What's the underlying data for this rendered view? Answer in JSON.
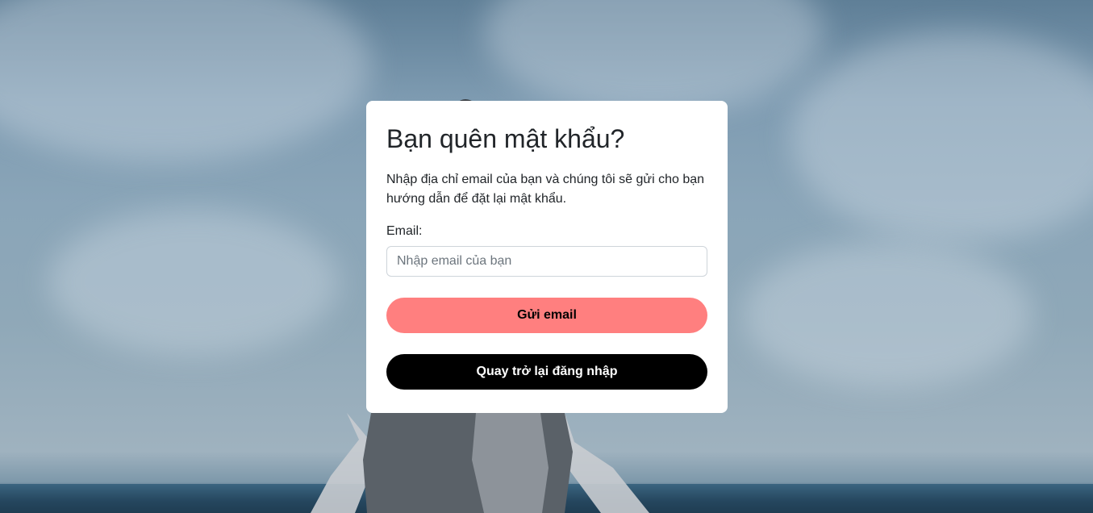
{
  "colors": {
    "primary_button_bg": "#ff7f7f",
    "secondary_button_bg": "#000000",
    "card_bg": "#ffffff",
    "text": "#212529"
  },
  "background": {
    "icon": "whale-photo"
  },
  "form": {
    "title": "Bạn quên mật khẩu?",
    "description": "Nhập địa chỉ email của bạn và chúng tôi sẽ gửi cho bạn hướng dẫn để đặt lại mật khẩu.",
    "email_label": "Email:",
    "email_placeholder": "Nhập email của bạn",
    "email_value": "",
    "send_button": "Gửi email",
    "back_button": "Quay trở lại đăng nhập"
  }
}
